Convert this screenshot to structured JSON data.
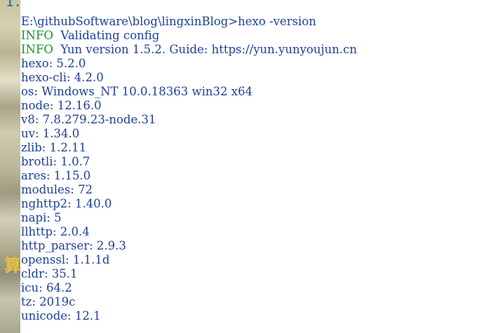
{
  "desktop": {
    "top_glyph": "1.",
    "side_glyph": "算"
  },
  "terminal": {
    "prompt_command": "E:\\githubSoftware\\blog\\lingxinBlog>hexo -version",
    "info_lines": [
      {
        "tag": "INFO",
        "text": "  Validating config"
      },
      {
        "tag": "INFO",
        "text": "  Yun version 1.5.2. Guide: https://yun.yunyoujun.cn"
      }
    ],
    "output_lines": [
      "hexo: 5.2.0",
      "hexo-cli: 4.2.0",
      "os: Windows_NT 10.0.18363 win32 x64",
      "node: 12.16.0",
      "v8: 7.8.279.23-node.31",
      "uv: 1.34.0",
      "zlib: 1.2.11",
      "brotli: 1.0.7",
      "ares: 1.15.0",
      "modules: 72",
      "nghttp2: 1.40.0",
      "napi: 5",
      "llhttp: 2.0.4",
      "http_parser: 2.9.3",
      "openssl: 1.1.1d",
      "cldr: 35.1",
      "icu: 64.2",
      "tz: 2019c",
      "unicode: 12.1"
    ],
    "colors": {
      "text": "#1c3fa8",
      "info_tag": "#0f9a25",
      "background": "#ffffff"
    }
  }
}
